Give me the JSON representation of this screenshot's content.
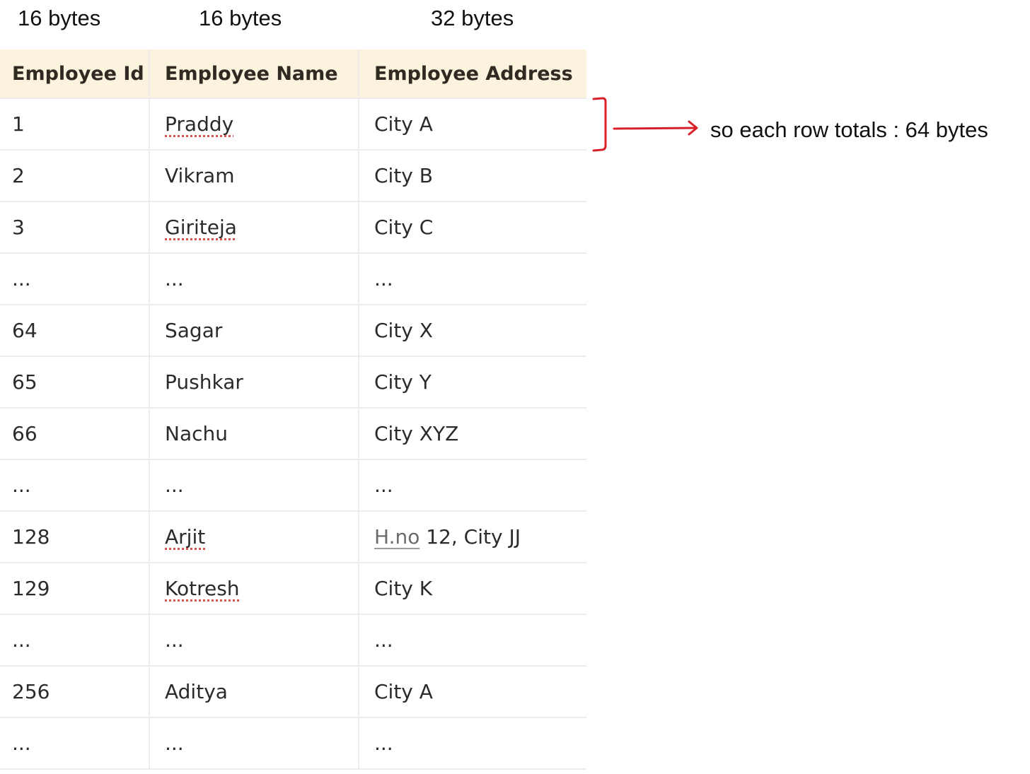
{
  "column_sizes": [
    "16 bytes",
    "16 bytes",
    "32 bytes"
  ],
  "table": {
    "headers": [
      "Employee Id",
      "Employee Name",
      "Employee Address"
    ],
    "rows": [
      {
        "id": "1",
        "name": "Praddy",
        "address": "City A"
      },
      {
        "id": "2",
        "name": "Vikram",
        "address": "City B"
      },
      {
        "id": "3",
        "name": "Giriteja",
        "address": "City C"
      },
      {
        "id": "...",
        "name": "...",
        "address": "..."
      },
      {
        "id": "64",
        "name": "Sagar",
        "address": "City X"
      },
      {
        "id": "65",
        "name": "Pushkar",
        "address": "City Y"
      },
      {
        "id": "66",
        "name": "Nachu",
        "address": "City XYZ"
      },
      {
        "id": "...",
        "name": "...",
        "address": "..."
      },
      {
        "id": "128",
        "name": "Arjit",
        "address_prefix": "H.no",
        "address": " 12, City JJ"
      },
      {
        "id": "129",
        "name": "Kotresh",
        "address": "City K"
      },
      {
        "id": "...",
        "name": "...",
        "address": "..."
      },
      {
        "id": "256",
        "name": "Aditya",
        "address": "City A"
      },
      {
        "id": "...",
        "name": "...",
        "address": "..."
      }
    ]
  },
  "annotation": {
    "text": "so each row totals : 64 bytes",
    "color": "#d8202a"
  }
}
